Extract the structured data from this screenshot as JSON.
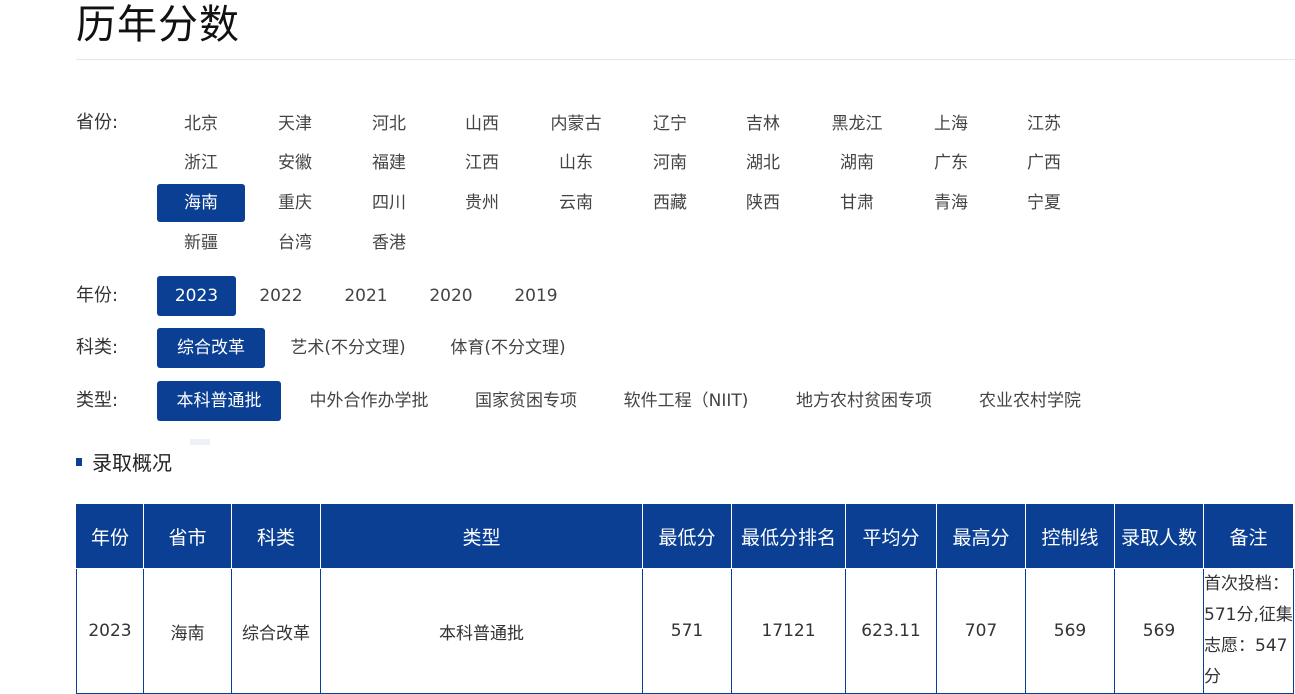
{
  "page_title": "历年分数",
  "filters": {
    "province": {
      "label": "省份:",
      "selected": "海南",
      "options": [
        "北京",
        "天津",
        "河北",
        "山西",
        "内蒙古",
        "辽宁",
        "吉林",
        "黑龙江",
        "上海",
        "江苏",
        "浙江",
        "安徽",
        "福建",
        "江西",
        "山东",
        "河南",
        "湖北",
        "湖南",
        "广东",
        "广西",
        "海南",
        "重庆",
        "四川",
        "贵州",
        "云南",
        "西藏",
        "陕西",
        "甘肃",
        "青海",
        "宁夏",
        "新疆",
        "台湾",
        "香港"
      ]
    },
    "year": {
      "label": "年份:",
      "selected": "2023",
      "options": [
        "2023",
        "2022",
        "2021",
        "2020",
        "2019"
      ]
    },
    "category": {
      "label": "科类:",
      "selected": "综合改革",
      "options": [
        "综合改革",
        "艺术(不分文理)",
        "体育(不分文理)"
      ]
    },
    "type": {
      "label": "类型:",
      "selected": "本科普通批",
      "options": [
        "本科普通批",
        "中外合作办学批",
        "国家贫困专项",
        "软件工程（NIIT)",
        "地方农村贫困专项",
        "农业农村学院"
      ]
    }
  },
  "section": {
    "title": "录取概况"
  },
  "table": {
    "headers": [
      "年份",
      "省市",
      "科类",
      "类型",
      "最低分",
      "最低分排名",
      "平均分",
      "最高分",
      "控制线",
      "录取人数",
      "备注"
    ],
    "rows": [
      [
        "2023",
        "海南",
        "综合改革",
        "本科普通批",
        "571",
        "17121",
        "623.11",
        "707",
        "569",
        "569",
        "首次投档：571分,征集志愿：547分"
      ]
    ]
  },
  "colors": {
    "accent": "#0a3f94"
  }
}
